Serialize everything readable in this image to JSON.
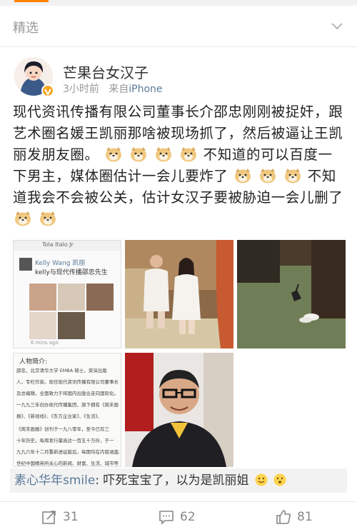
{
  "section": {
    "title": "精选"
  },
  "post": {
    "username": "芒果台女汉子",
    "time": "3小时前",
    "source_prefix": "来自",
    "source": "iPhone",
    "text_parts": [
      "现代资讯传播有限公司董事长介邵忠刚刚被捉奸，跟艺术圈名媛王凯丽那啥被现场抓了，然后被逼让王凯丽发朋友圈。",
      "不知道的可以百度一下男主，媒体圈估计一会儿要炸了",
      "不知道我会不会被公关，估计女汉子要被胁迫一会儿删了"
    ]
  },
  "images": {
    "screenshot": {
      "app_header": "Tola Italo Jr",
      "name": "Kelly Wang 凯丽",
      "caption": "kelly与现代传播邵忠先生",
      "time": "6 mins ago"
    },
    "bio": {
      "heading": "人物简介:",
      "lines": [
        "邵忠，北京清华大学 EMBA 硕士，资深出版",
        "人，专栏作家。现任现代资讯传播有限公司董事长",
        "及总编辑，全面致力于将国内出版业走向国际化。",
        "一九九三年创办现代传播集团，旗下拥有《周末画",
        "报》、《新视线》、《东方企业家》、《生活》、",
        "《周末画报》创刊于一九八零年，至今已有三",
        "十年历史，每周发行量高达一百五十万份，于一",
        "九九六年十二月重新进驻版后，每期均在内容涵盖新",
        "世纪中国精英所关心的新闻、财富、生活、城市等"
      ]
    }
  },
  "comment": {
    "name": "素心华年smile",
    "text": ": 吓死宝宝了，以为是凯丽姐"
  },
  "actions": {
    "repost": "31",
    "comments": "62",
    "likes": "81"
  },
  "colors": {
    "accent": "#ff8200",
    "link": "#5b7a99",
    "muted": "#999999"
  }
}
